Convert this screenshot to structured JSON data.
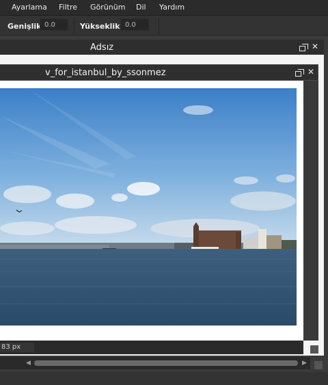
{
  "menu": {
    "items": [
      {
        "label": "Ayarlama"
      },
      {
        "label": "Filtre"
      },
      {
        "label": "Görünüm"
      },
      {
        "label": "Dil"
      },
      {
        "label": "Yardım"
      }
    ]
  },
  "options": {
    "width_label": "Genişlik:",
    "width_value": "0.0",
    "height_label": "Yükseklik:",
    "height_value": "0.0"
  },
  "outer_window": {
    "title": "Adsız"
  },
  "inner_window": {
    "title": "v_for_istanbul_by_ssonmez"
  },
  "status": {
    "size_text": "83 px"
  },
  "icons": {
    "restore": "restore-icon",
    "close": "close-icon"
  }
}
